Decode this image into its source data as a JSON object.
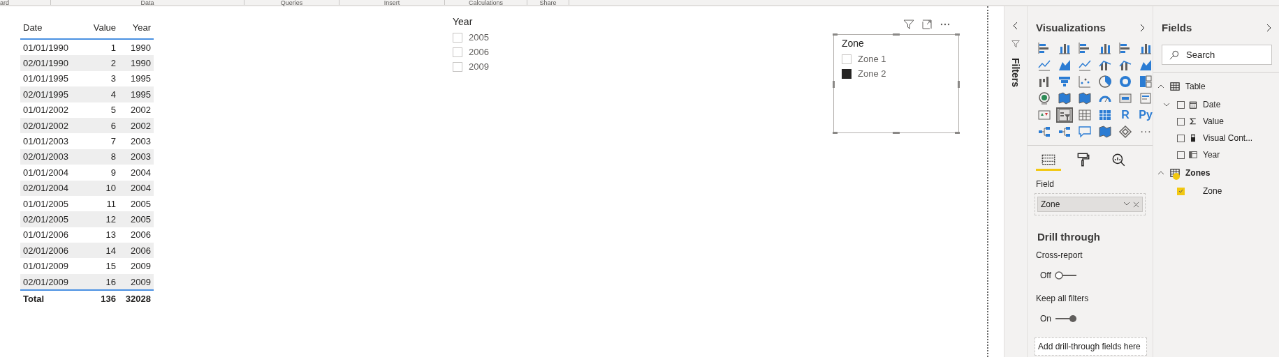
{
  "ribbon": {
    "groups": [
      "ard",
      "Data",
      "Queries",
      "Insert",
      "Calculations",
      "Share"
    ]
  },
  "table_visual": {
    "columns": [
      "Date",
      "Value",
      "Year"
    ],
    "rows": [
      [
        "01/01/1990",
        "1",
        "1990"
      ],
      [
        "02/01/1990",
        "2",
        "1990"
      ],
      [
        "01/01/1995",
        "3",
        "1995"
      ],
      [
        "02/01/1995",
        "4",
        "1995"
      ],
      [
        "01/01/2002",
        "5",
        "2002"
      ],
      [
        "02/01/2002",
        "6",
        "2002"
      ],
      [
        "01/01/2003",
        "7",
        "2003"
      ],
      [
        "02/01/2003",
        "8",
        "2003"
      ],
      [
        "01/01/2004",
        "9",
        "2004"
      ],
      [
        "02/01/2004",
        "10",
        "2004"
      ],
      [
        "01/01/2005",
        "11",
        "2005"
      ],
      [
        "02/01/2005",
        "12",
        "2005"
      ],
      [
        "01/01/2006",
        "13",
        "2006"
      ],
      [
        "02/01/2006",
        "14",
        "2006"
      ],
      [
        "01/01/2009",
        "15",
        "2009"
      ],
      [
        "02/01/2009",
        "16",
        "2009"
      ]
    ],
    "total": [
      "Total",
      "136",
      "32028"
    ]
  },
  "year_slicer": {
    "title": "Year",
    "items": [
      {
        "label": "2005",
        "checked": false
      },
      {
        "label": "2006",
        "checked": false
      },
      {
        "label": "2009",
        "checked": false
      }
    ]
  },
  "zone_slicer": {
    "title": "Zone",
    "selected": true,
    "items": [
      {
        "label": "Zone 1",
        "checked": false
      },
      {
        "label": "Zone 2",
        "checked": true
      }
    ]
  },
  "filters_pane": {
    "title": "Filters"
  },
  "visualizations": {
    "title": "Visualizations",
    "visual_types": [
      {
        "kind": "bar",
        "selected": false
      },
      {
        "kind": "column",
        "selected": false
      },
      {
        "kind": "bar",
        "selected": false
      },
      {
        "kind": "column",
        "selected": false
      },
      {
        "kind": "bar",
        "selected": false
      },
      {
        "kind": "column",
        "selected": false
      },
      {
        "kind": "line",
        "selected": false
      },
      {
        "kind": "area",
        "selected": false
      },
      {
        "kind": "line",
        "selected": false
      },
      {
        "kind": "combo",
        "selected": false
      },
      {
        "kind": "combo",
        "selected": false
      },
      {
        "kind": "area",
        "selected": false
      },
      {
        "kind": "waterfall",
        "selected": false
      },
      {
        "kind": "funnel",
        "selected": false
      },
      {
        "kind": "scatter",
        "selected": false
      },
      {
        "kind": "pie",
        "selected": false
      },
      {
        "kind": "donut",
        "selected": false
      },
      {
        "kind": "treemap",
        "selected": false
      },
      {
        "kind": "globe",
        "selected": false
      },
      {
        "kind": "map",
        "selected": false
      },
      {
        "kind": "map",
        "selected": false
      },
      {
        "kind": "gauge",
        "selected": false
      },
      {
        "kind": "card",
        "selected": false
      },
      {
        "kind": "text",
        "selected": false
      },
      {
        "kind": "kpi",
        "selected": false
      },
      {
        "kind": "slicer",
        "selected": true
      },
      {
        "kind": "table",
        "selected": false
      },
      {
        "kind": "matrix",
        "selected": false
      },
      {
        "kind": "label",
        "label": "R",
        "selected": false
      },
      {
        "kind": "label",
        "label": "Py",
        "selected": false
      },
      {
        "kind": "tree",
        "selected": false
      },
      {
        "kind": "tree",
        "selected": false
      },
      {
        "kind": "chat",
        "selected": false
      },
      {
        "kind": "map",
        "selected": false
      },
      {
        "kind": "shape",
        "selected": false
      },
      {
        "kind": "label",
        "label": "···",
        "selected": false
      }
    ],
    "tabs": [
      {
        "kind": "fields",
        "selected": true
      },
      {
        "kind": "format",
        "selected": false
      },
      {
        "kind": "analytics",
        "selected": false
      }
    ],
    "field_well": {
      "label": "Field",
      "value": "Zone"
    },
    "drill_through": {
      "title": "Drill through",
      "toggles": [
        {
          "label": "Cross-report",
          "state": "Off",
          "on": false
        },
        {
          "label": "Keep all filters",
          "state": "On",
          "on": true
        }
      ],
      "drop_zone": "Add drill-through fields here"
    }
  },
  "fields": {
    "title": "Fields",
    "search": {
      "placeholder": "Search"
    },
    "tables": [
      {
        "name": "Table",
        "expanded": true,
        "in_use": false,
        "fields": [
          {
            "name": "Date",
            "kind": "date",
            "checked": false,
            "expanded": false
          },
          {
            "name": "Value",
            "kind": "sum",
            "checked": false
          },
          {
            "name": "Visual Cont...",
            "kind": "measure",
            "checked": false
          },
          {
            "name": "Year",
            "kind": "year",
            "checked": false
          }
        ]
      },
      {
        "name": "Zones",
        "expanded": true,
        "in_use": true,
        "fields": [
          {
            "name": "Zone",
            "kind": "column",
            "checked": true
          }
        ]
      }
    ]
  }
}
